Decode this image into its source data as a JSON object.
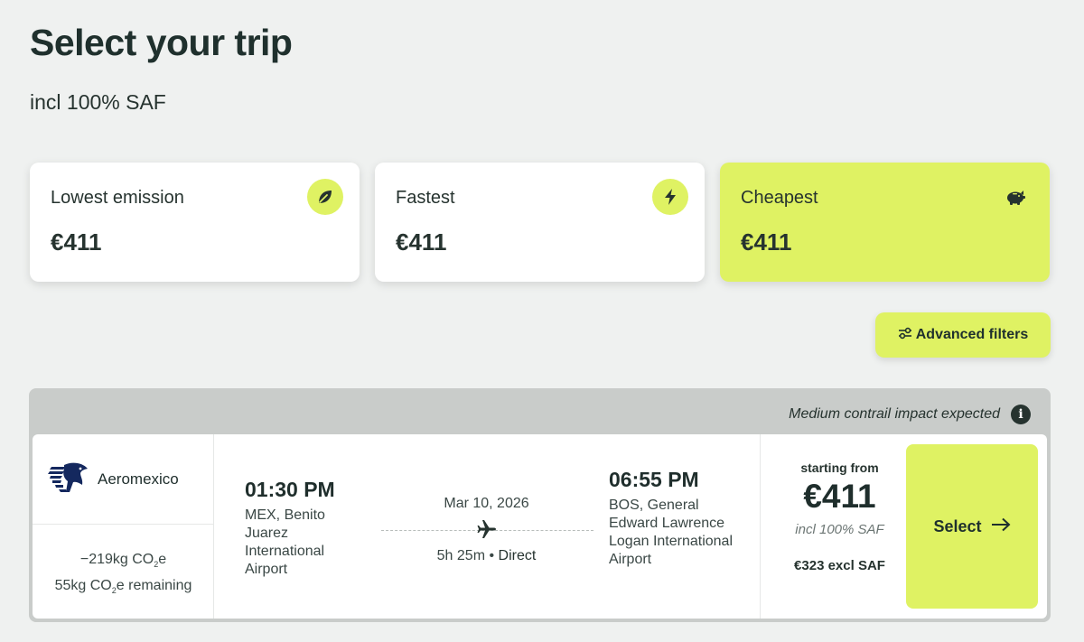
{
  "header": {
    "title": "Select your trip",
    "subtitle": "incl 100% SAF"
  },
  "sort_cards": [
    {
      "label": "Lowest emission",
      "price": "€411",
      "icon": "leaf-icon",
      "active": false
    },
    {
      "label": "Fastest",
      "price": "€411",
      "icon": "lightning-icon",
      "active": false
    },
    {
      "label": "Cheapest",
      "price": "€411",
      "icon": "piggy-bank-icon",
      "active": true
    }
  ],
  "filters": {
    "label": "Advanced filters",
    "icon": "sliders-icon"
  },
  "flight": {
    "contrail_notice": "Medium contrail impact expected",
    "airline": "Aeromexico",
    "emissions": {
      "saved_prefix": "−219kg CO",
      "saved_sub": "2",
      "saved_suffix": "e",
      "remaining_prefix": "55kg CO",
      "remaining_sub": "2",
      "remaining_suffix": "e remaining"
    },
    "departure": {
      "time": "01:30 PM",
      "airport": "MEX, Benito Juarez International Airport"
    },
    "date": "Mar 10, 2026",
    "duration": "5h 25m",
    "separator": "•",
    "stops": "Direct",
    "arrival": {
      "time": "06:55 PM",
      "airport": "BOS, General Edward Lawrence Logan International Airport"
    },
    "price": {
      "from_label": "starting from",
      "amount": "€411",
      "saf_note": "incl 100% SAF",
      "excl_saf": "€323 excl SAF"
    },
    "select_label": "Select"
  },
  "colors": {
    "accent": "#dff263",
    "background": "#eff1f0",
    "text_dark": "#1f302d",
    "notice_bar": "#c9ccca"
  }
}
